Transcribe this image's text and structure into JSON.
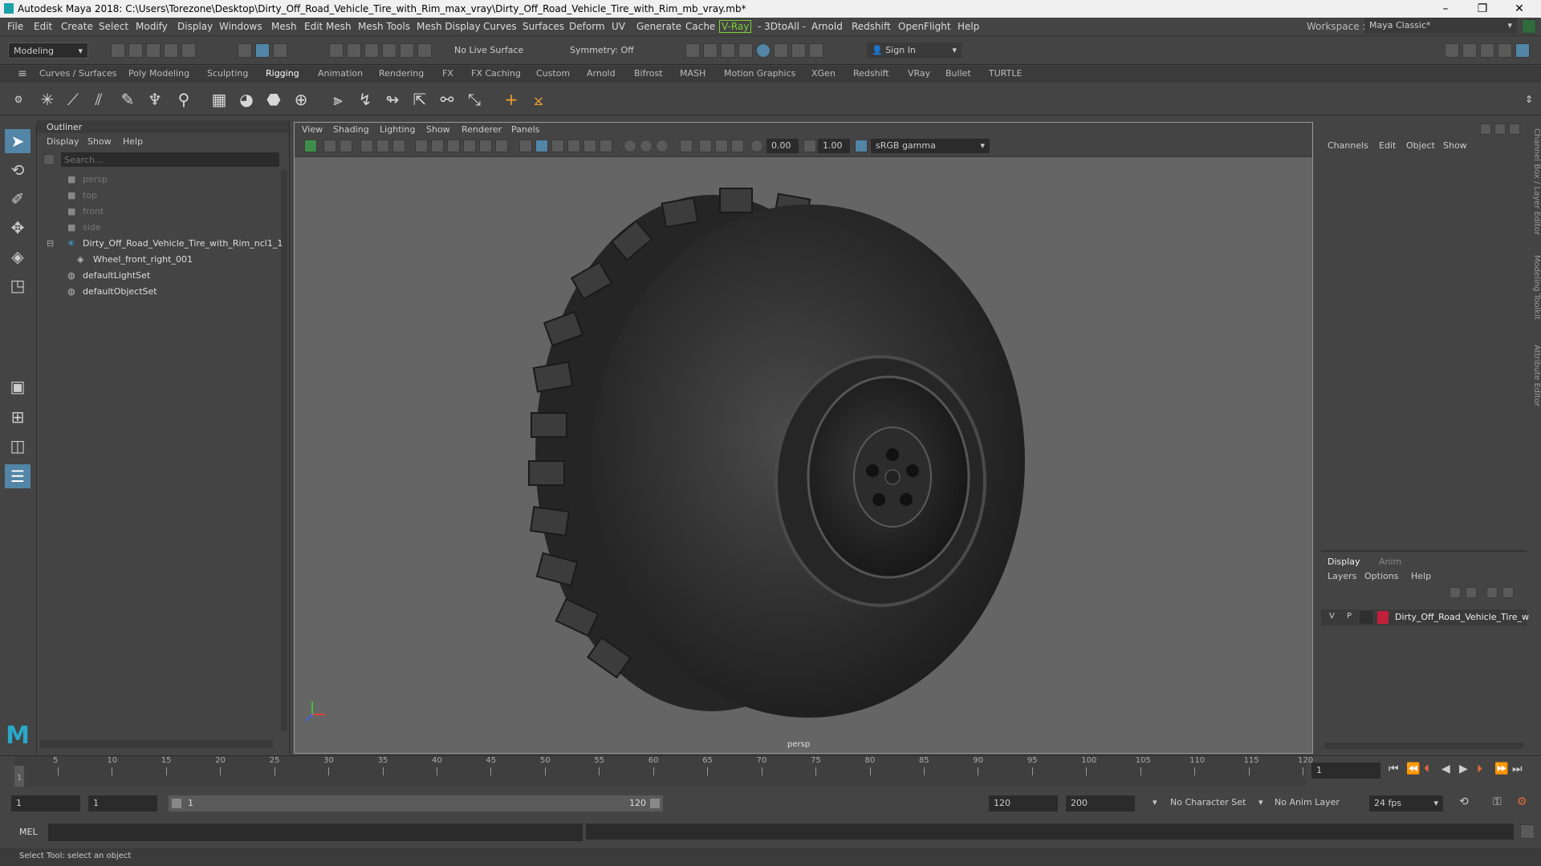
{
  "window": {
    "title": "Autodesk Maya 2018: C:\\Users\\Torezone\\Desktop\\Dirty_Off_Road_Vehicle_Tire_with_Rim_max_vray\\Dirty_Off_Road_Vehicle_Tire_with_Rim_mb_vray.mb*",
    "minimize": "–",
    "maximize": "❐",
    "close": "✕"
  },
  "menubar": {
    "items": [
      "File",
      "Edit",
      "Create",
      "Select",
      "Modify",
      "Display",
      "Windows",
      "Mesh",
      "Edit Mesh",
      "Mesh Tools",
      "Mesh Display",
      "Curves",
      "Surfaces",
      "Deform",
      "UV",
      "Generate",
      "Cache",
      "V-Ray",
      "- 3DtoAll -",
      "Arnold",
      "Redshift",
      "OpenFlight",
      "Help"
    ],
    "workspace_label": "Workspace :",
    "workspace_value": "Maya Classic*"
  },
  "statusline": {
    "mode": "Modeling",
    "live_surface": "No Live Surface",
    "symmetry": "Symmetry: Off",
    "sign_in": "Sign In"
  },
  "shelf": {
    "tabs": [
      "Curves / Surfaces",
      "Poly Modeling",
      "Sculpting",
      "Rigging",
      "Animation",
      "Rendering",
      "FX",
      "FX Caching",
      "Custom",
      "Arnold",
      "Bifrost",
      "MASH",
      "Motion Graphics",
      "XGen",
      "Redshift",
      "VRay",
      "Bullet",
      "TURTLE"
    ],
    "active_tab": "Rigging"
  },
  "outliner": {
    "title": "Outliner",
    "menu": [
      "Display",
      "Show",
      "Help"
    ],
    "search_placeholder": "Search...",
    "items": [
      {
        "label": "persp",
        "indent": 0,
        "type": "camera",
        "dim": true
      },
      {
        "label": "top",
        "indent": 0,
        "type": "camera",
        "dim": true
      },
      {
        "label": "front",
        "indent": 0,
        "type": "camera",
        "dim": true
      },
      {
        "label": "side",
        "indent": 0,
        "type": "camera",
        "dim": true
      },
      {
        "label": "Dirty_Off_Road_Vehicle_Tire_with_Rim_ncl1_1",
        "indent": 0,
        "type": "group",
        "dim": false
      },
      {
        "label": "Wheel_front_right_001",
        "indent": 1,
        "type": "mesh",
        "dim": false
      },
      {
        "label": "defaultLightSet",
        "indent": 0,
        "type": "set",
        "dim": false
      },
      {
        "label": "defaultObjectSet",
        "indent": 0,
        "type": "set",
        "dim": false
      }
    ]
  },
  "viewport": {
    "menu": [
      "View",
      "Shading",
      "Lighting",
      "Show",
      "Renderer",
      "Panels"
    ],
    "exposure": "0.00",
    "gamma": "1.00",
    "color_space": "sRGB gamma",
    "camera_label": "persp"
  },
  "channelbox": {
    "menu": [
      "Channels",
      "Edit",
      "Object",
      "Show"
    ],
    "side_tabs": [
      "Channel Box / Layer Editor",
      "Modeling Toolkit",
      "Attribute Editor"
    ]
  },
  "layers": {
    "tabs": [
      "Display",
      "Anim"
    ],
    "menu": [
      "Layers",
      "Options",
      "Help"
    ],
    "row": {
      "v": "V",
      "p": "P",
      "name": "Dirty_Off_Road_Vehicle_Tire_w",
      "color": "#c0203a"
    }
  },
  "timeline": {
    "ticks": [
      "5",
      "10",
      "15",
      "20",
      "25",
      "30",
      "35",
      "40",
      "45",
      "50",
      "55",
      "60",
      "65",
      "70",
      "75",
      "80",
      "85",
      "90",
      "95",
      "100",
      "105",
      "110",
      "115",
      "120"
    ],
    "start_tick": "1",
    "current_frame": "1"
  },
  "range": {
    "start": "1",
    "playback_start": "1",
    "slider_start": "1",
    "slider_end": "120",
    "playback_end": "120",
    "end": "200",
    "character_set": "No Character Set",
    "anim_layer": "No Anim Layer",
    "fps": "24 fps"
  },
  "cmdline": {
    "label": "MEL"
  },
  "helpline": {
    "text": "Select Tool: select an object"
  },
  "colors": {
    "accent": "#5285a6",
    "vray": "#7bd136",
    "layer": "#c0203a"
  }
}
